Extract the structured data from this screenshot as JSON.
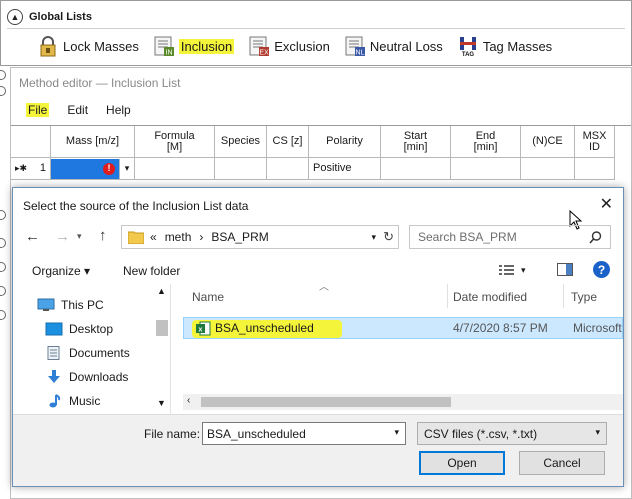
{
  "global_lists": {
    "title": "Global Lists",
    "items": [
      {
        "label": "Lock Masses",
        "icon": "lock-icon"
      },
      {
        "label": "Inclusion",
        "icon": "inclusion-list-icon"
      },
      {
        "label": "Exclusion",
        "icon": "exclusion-list-icon"
      },
      {
        "label": "Neutral Loss",
        "icon": "neutral-loss-icon"
      },
      {
        "label": "Tag Masses",
        "icon": "tag-masses-icon"
      }
    ]
  },
  "method_editor": {
    "title": "Method editor — Inclusion List",
    "menu": [
      "File",
      "Edit",
      "Help"
    ],
    "columns": [
      "Mass [m/z]",
      "Formula\n[M]",
      "Species",
      "CS [z]",
      "Polarity",
      "Start\n[min]",
      "End\n[min]",
      "(N)CE",
      "MSX\nID"
    ],
    "row": {
      "marker": "▸✱",
      "number": "1",
      "polarity": "Positive"
    }
  },
  "file_dialog": {
    "title": "Select the source of the Inclusion List data",
    "breadcrumb": [
      "«",
      "meth",
      "›",
      "BSA_PRM"
    ],
    "search_placeholder": "Search BSA_PRM",
    "organize_label": "Organize ▾",
    "new_folder_label": "New folder",
    "nav_items": [
      {
        "label": "This PC",
        "icon": "computer-icon"
      },
      {
        "label": "Desktop",
        "icon": "desktop-icon"
      },
      {
        "label": "Documents",
        "icon": "documents-icon"
      },
      {
        "label": "Downloads",
        "icon": "downloads-icon"
      },
      {
        "label": "Music",
        "icon": "music-icon"
      }
    ],
    "columns": {
      "name": "Name",
      "date": "Date modified",
      "type": "Type"
    },
    "files": [
      {
        "name": "BSA_unscheduled",
        "date": "4/7/2020 8:57 PM",
        "type": "Microsoft"
      }
    ],
    "file_name_label": "File name:",
    "file_name_value": "BSA_unscheduled",
    "filter_value": "CSV files (*.csv, *.txt)",
    "open_label": "Open",
    "cancel_label": "Cancel"
  },
  "colors": {
    "highlight": "#f4f43a",
    "accent": "#0078d7",
    "selection": "#cce8ff"
  }
}
